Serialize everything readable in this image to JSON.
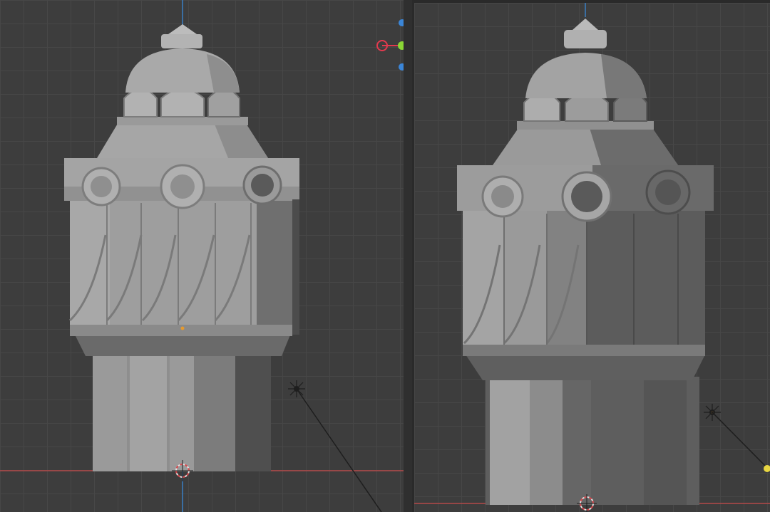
{
  "viewports": [
    {
      "id": "left",
      "view": "front-orthographic",
      "light": "sun"
    },
    {
      "id": "right",
      "view": "front-orthographic",
      "light": "sun"
    }
  ],
  "colors": {
    "background": "#3d3d3d",
    "grid": "#474747",
    "x_axis": "#b34a4a",
    "z_axis": "#3a7fc4",
    "gizmo_x": "#e23a4e",
    "gizmo_y": "#8ad635",
    "gizmo_z": "#3b86d8",
    "light_handle": "#e8d642",
    "model_light": "#a6a6a6",
    "model_shadow": "#5e5e5e"
  },
  "icons": [
    "3d-cursor-icon",
    "sun-lamp-icon",
    "navigation-gizmo-icon"
  ]
}
